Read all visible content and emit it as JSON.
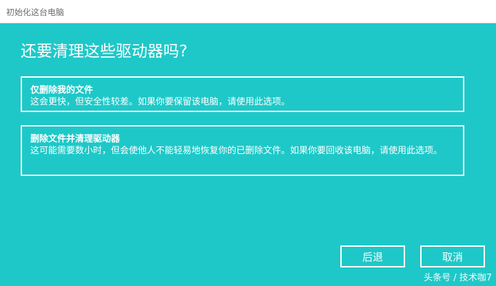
{
  "window": {
    "title": "初始化这台电脑"
  },
  "main": {
    "heading": "还要清理这些驱动器吗?",
    "options": [
      {
        "title": "仅删除我的文件",
        "description": "这会更快，但安全性较差。如果你要保留该电脑，请使用此选项。"
      },
      {
        "title": "删除文件并清理驱动器",
        "description": "这可能需要数小时，但会使他人不能轻易地恢复你的已删除文件。如果你要回收该电脑，请使用此选项。"
      }
    ]
  },
  "buttons": {
    "back": "后退",
    "cancel": "取消"
  },
  "watermark": "头条号 / 技术咖7",
  "colors": {
    "background": "#1fc8c8",
    "foreground": "#ffffff",
    "titlebar": "#ffffff"
  }
}
